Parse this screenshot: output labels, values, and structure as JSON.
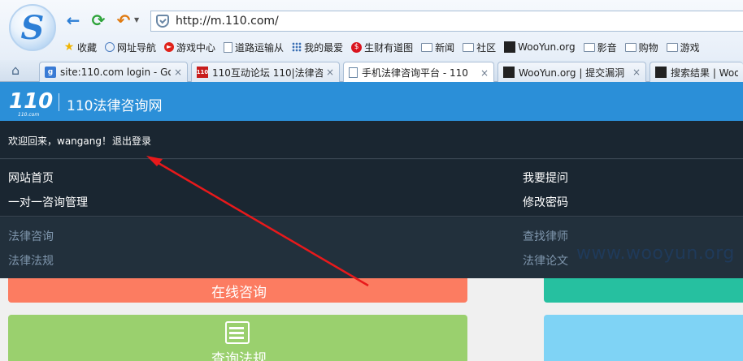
{
  "browser": {
    "logo_letter": "S",
    "address": "http://m.110.com/",
    "bookmarks": [
      {
        "label": "收藏",
        "icon": "star-icon"
      },
      {
        "label": "网址导航",
        "icon": "globe-icon"
      },
      {
        "label": "游戏中心",
        "icon": "game-icon"
      },
      {
        "label": "道路运输从",
        "icon": "page-icon"
      },
      {
        "label": "我的最爱",
        "icon": "grid-icon"
      },
      {
        "label": "生财有道图",
        "icon": "money-icon"
      },
      {
        "label": "新闻",
        "icon": "folder-icon"
      },
      {
        "label": "社区",
        "icon": "folder-icon"
      },
      {
        "label": "WooYun.org",
        "icon": "wooyun-icon"
      },
      {
        "label": "影音",
        "icon": "folder-icon"
      },
      {
        "label": "购物",
        "icon": "folder-icon"
      },
      {
        "label": "游戏",
        "icon": "folder-icon"
      }
    ],
    "tabs": [
      {
        "label": "site:110.com login - Go",
        "icon": "google-icon",
        "icon_text": "g"
      },
      {
        "label": "110互动论坛 110|法律咨",
        "icon": "site110-icon",
        "icon_text": "110"
      },
      {
        "label": "手机法律咨询平台 - 110",
        "icon": "page-icon",
        "icon_text": ""
      },
      {
        "label": "WooYun.org | 提交漏洞",
        "icon": "wooyun-icon",
        "icon_text": ""
      },
      {
        "label": "搜索结果 | Woo",
        "icon": "wooyun-icon",
        "icon_text": ""
      }
    ],
    "close_glyph": "×"
  },
  "site": {
    "logo": "110",
    "logo_sub": "110.com",
    "title": "110法律咨询网",
    "welcome": "欢迎回来，wangang！",
    "logout": "退出登录",
    "menu_primary": {
      "home": "网站首页",
      "ask": "我要提问",
      "consult_manage": "一对一咨询管理",
      "change_password": "修改密码"
    },
    "menu_secondary": {
      "legal_consult": "法律咨询",
      "find_lawyer": "查找律师",
      "laws": "法律法规",
      "papers": "法律论文"
    },
    "tiles": {
      "online_consult": "在线咨询",
      "query_laws": "查询法规"
    },
    "watermark": "www.wooyun.org"
  },
  "colors": {
    "header_blue": "#2b8fd8",
    "drawer_dark": "#1a2631",
    "tile_orange": "#fc7c61",
    "tile_teal": "#26c0a0",
    "tile_green": "#9ad06e",
    "tile_sky": "#7fd3f5",
    "annotation_red": "#e8191b"
  }
}
